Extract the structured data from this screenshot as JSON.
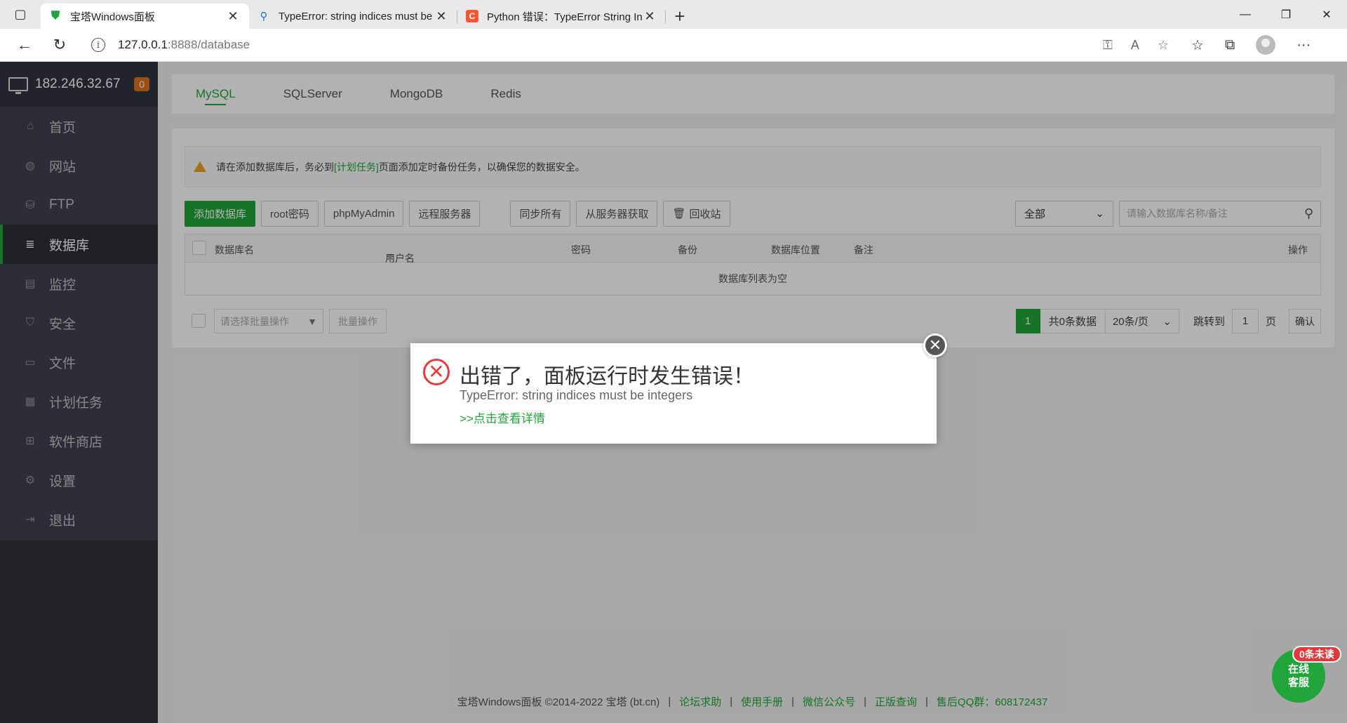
{
  "browser": {
    "tabs": [
      {
        "title": "宝塔Windows面板",
        "active": true
      },
      {
        "title": "TypeError: string indices must be"
      },
      {
        "title": "Python 错误：TypeError String In"
      }
    ],
    "url_host": "127.0.0.1",
    "url_path": ":8888/database"
  },
  "sidebar": {
    "server_ip": "182.246.32.67",
    "badge": "0",
    "items": [
      {
        "label": "首页",
        "icon": "home-icon"
      },
      {
        "label": "网站",
        "icon": "globe-icon"
      },
      {
        "label": "FTP",
        "icon": "ftp-icon"
      },
      {
        "label": "数据库",
        "icon": "database-icon",
        "active": true
      },
      {
        "label": "监控",
        "icon": "monitor-icon"
      },
      {
        "label": "安全",
        "icon": "shield-icon"
      },
      {
        "label": "文件",
        "icon": "folder-icon"
      },
      {
        "label": "计划任务",
        "icon": "calendar-icon"
      },
      {
        "label": "软件商店",
        "icon": "apps-icon"
      },
      {
        "label": "设置",
        "icon": "gear-icon"
      },
      {
        "label": "退出",
        "icon": "logout-icon"
      }
    ]
  },
  "db_tabs": [
    "MySQL",
    "SQLServer",
    "MongoDB",
    "Redis"
  ],
  "notice": {
    "before": "请在添加数据库后，务必到",
    "link": "[计划任务]",
    "after": "页面添加定时备份任务，以确保您的数据安全。"
  },
  "toolbar": {
    "add_db": "添加数据库",
    "root_pwd": "root密码",
    "phpmyadmin": "phpMyAdmin",
    "remote": "远程服务器",
    "sync_all": "同步所有",
    "fetch": "从服务器获取",
    "recycle": "回收站",
    "filter": "全部",
    "search_placeholder": "请输入数据库名称/备注"
  },
  "table": {
    "headers": [
      "数据库名",
      "用户名",
      "密码",
      "备份",
      "数据库位置",
      "备注",
      "操作"
    ],
    "empty": "数据库列表为空"
  },
  "batch": {
    "select_placeholder": "请选择批量操作",
    "button": "批量操作"
  },
  "pager": {
    "current": "1",
    "total": "共0条数据",
    "page_size": "20条/页",
    "jump_label": "跳转到",
    "jump_value": "1",
    "page_unit": "页",
    "confirm": "确认"
  },
  "footer": {
    "copyright": "宝塔Windows面板 ©2014-2022 宝塔 (bt.cn)",
    "links": [
      "论坛求助",
      "使用手册",
      "微信公众号",
      "正版查询",
      "售后QQ群：608172437"
    ]
  },
  "dialog": {
    "title": "出错了，面板运行时发生错误！",
    "message": "TypeError: string indices must be integers",
    "link": ">>点击查看详情"
  },
  "chat": {
    "line1": "在线",
    "line2": "客服",
    "badge": "0条未读"
  },
  "colors": {
    "accent": "#20a53a",
    "sidebar": "#3c444d",
    "error": "#e4393c",
    "badge": "#e0711a"
  }
}
